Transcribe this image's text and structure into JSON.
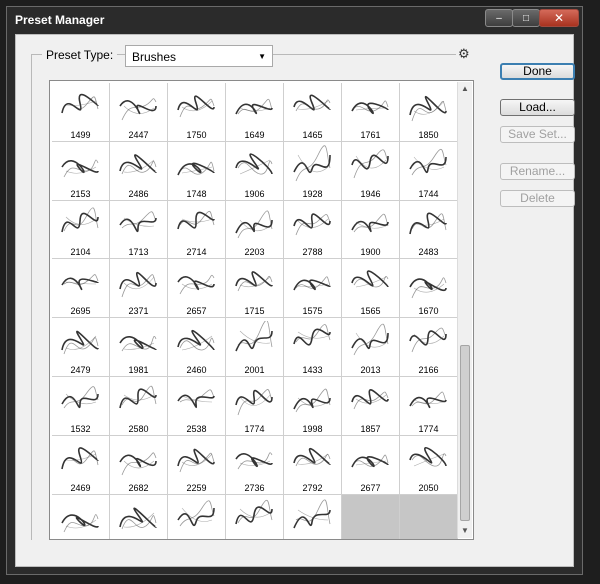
{
  "window": {
    "title": "Preset Manager",
    "close_glyph": "✕",
    "min_glyph": "–",
    "max_glyph": "□"
  },
  "preset": {
    "label": "Preset Type:",
    "value": "Brushes"
  },
  "gear_icon": "⚙",
  "buttons": {
    "done": "Done",
    "load": "Load...",
    "save_set": "Save Set...",
    "rename": "Rename...",
    "delete": "Delete"
  },
  "brushes": [
    "1499",
    "2447",
    "1750",
    "1649",
    "1465",
    "1761",
    "1850",
    "2153",
    "2486",
    "1748",
    "1906",
    "1928",
    "1946",
    "1744",
    "2104",
    "1713",
    "2714",
    "2203",
    "2788",
    "1900",
    "2483",
    "2695",
    "2371",
    "2657",
    "1715",
    "1575",
    "1565",
    "1670",
    "2479",
    "1981",
    "2460",
    "2001",
    "1433",
    "2013",
    "2166",
    "1532",
    "2580",
    "2538",
    "1774",
    "1998",
    "1857",
    "1774",
    "2469",
    "2682",
    "2259",
    "2736",
    "2792",
    "2677",
    "2050",
    "",
    "",
    "",
    "",
    "",
    "",
    ""
  ],
  "scroll_glyphs": {
    "up": "▲",
    "down": "▼"
  }
}
